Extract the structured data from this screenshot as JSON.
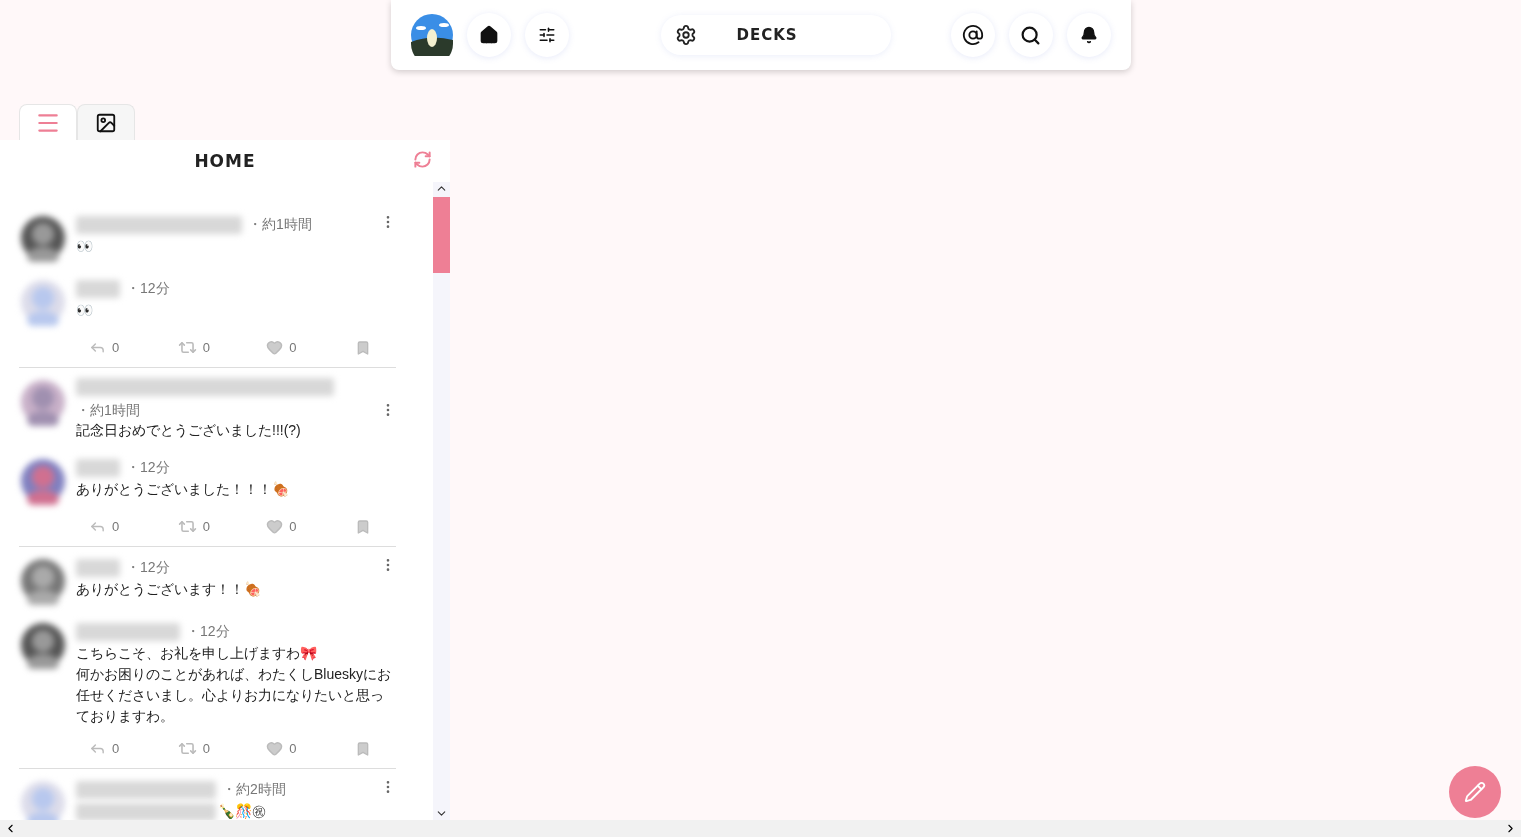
{
  "topbar": {
    "deck_label": "DECKS"
  },
  "column_tabs": [
    {
      "kind": "list",
      "selected": true
    },
    {
      "kind": "media",
      "selected": false
    }
  ],
  "column": {
    "title": "HOME"
  },
  "groups": [
    {
      "posts": [
        {
          "time": "・約1時間",
          "text": "👀"
        },
        {
          "time": "・12分",
          "text": "👀"
        }
      ],
      "actions": {
        "replies": "0",
        "reposts": "0",
        "likes": "0"
      }
    },
    {
      "posts": [
        {
          "time": "・約1時間",
          "text": "記念日おめでとうございました!!!(?)"
        },
        {
          "time": "・12分",
          "text": "ありがとうございました！！！🍖"
        }
      ],
      "actions": {
        "replies": "0",
        "reposts": "0",
        "likes": "0"
      }
    },
    {
      "posts": [
        {
          "time": "・12分",
          "text": "ありがとうございます！！🍖"
        },
        {
          "time": "・12分",
          "text": "こちらこそ、お礼を申し上げますわ🎀\n何かお困りのことがあれば、わたくしBlueskyにお任せくださいまし。心よりお力になりたいと思っておりますわ。"
        }
      ],
      "actions": {
        "replies": "0",
        "reposts": "0",
        "likes": "0"
      }
    },
    {
      "posts": [
        {
          "time": "・約2時間",
          "text": "🍾🎊㊗",
          "text_blurred_prefix": true
        }
      ]
    }
  ]
}
